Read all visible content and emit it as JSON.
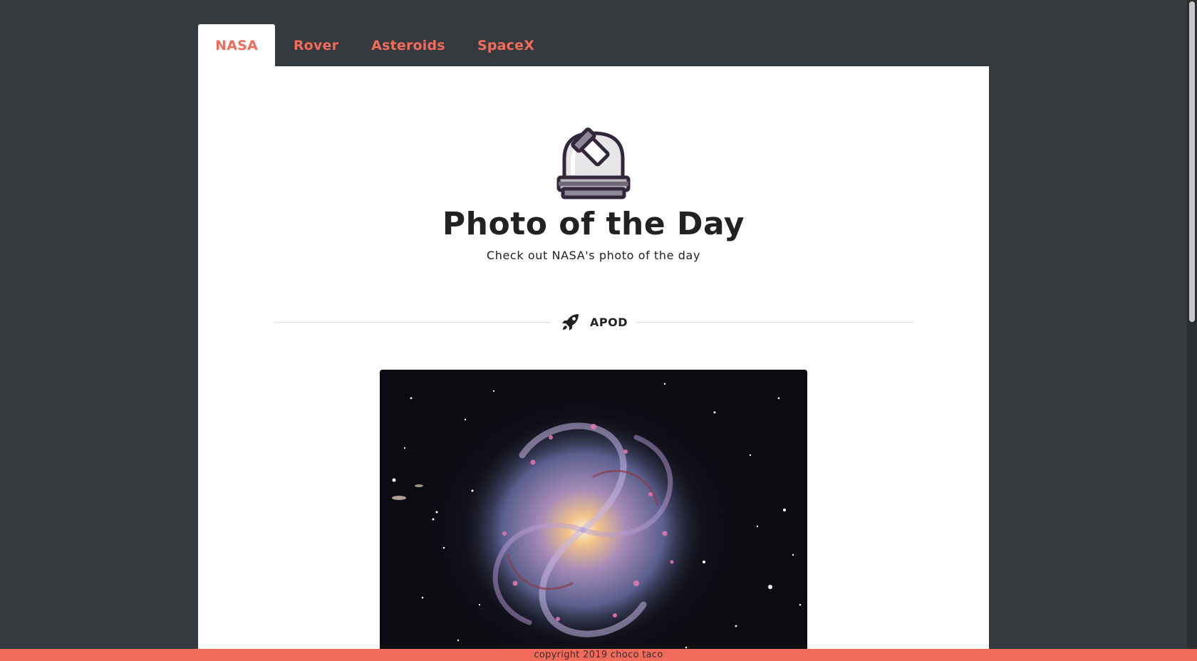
{
  "tabs": [
    {
      "label": "NASA",
      "active": true
    },
    {
      "label": "Rover",
      "active": false
    },
    {
      "label": "Asteroids",
      "active": false
    },
    {
      "label": "SpaceX",
      "active": false
    }
  ],
  "hero": {
    "icon": "observatory-icon",
    "title": "Photo of the Day",
    "subtitle": "Check out NASA's photo of the day"
  },
  "section": {
    "icon": "rocket-icon",
    "label": "APOD"
  },
  "photo": {
    "description_icon": "spiral-galaxy-image"
  },
  "footer": {
    "text": "copyright 2019 choco taco"
  },
  "colors": {
    "accent": "#f26b5b",
    "background": "#353a3e",
    "card": "#ffffff",
    "text": "#222222"
  }
}
